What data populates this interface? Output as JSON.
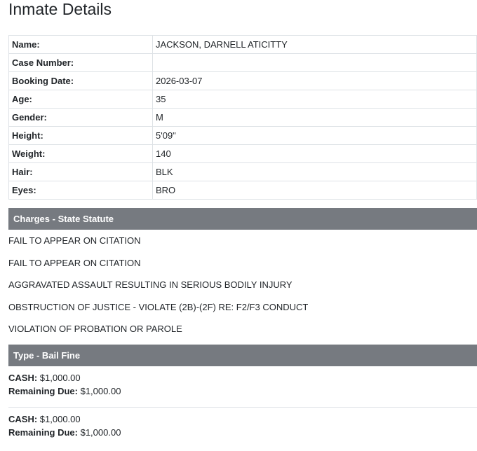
{
  "title": "Inmate Details",
  "details": [
    {
      "label": "Name:",
      "value": "JACKSON, DARNELL ATICITTY"
    },
    {
      "label": "Case Number:",
      "value": ""
    },
    {
      "label": "Booking Date:",
      "value": "2026-03-07"
    },
    {
      "label": "Age:",
      "value": "35"
    },
    {
      "label": "Gender:",
      "value": "M"
    },
    {
      "label": "Height:",
      "value": "5'09\""
    },
    {
      "label": "Weight:",
      "value": "140"
    },
    {
      "label": "Hair:",
      "value": "BLK"
    },
    {
      "label": "Eyes:",
      "value": "BRO"
    }
  ],
  "charges": {
    "header": "Charges - State Statute",
    "items": [
      "FAIL TO APPEAR ON CITATION",
      "FAIL TO APPEAR ON CITATION",
      "AGGRAVATED ASSAULT RESULTING IN SERIOUS BODILY INJURY",
      "OBSTRUCTION OF JUSTICE - VIOLATE (2B)-(2F) RE: F2/F3 CONDUCT",
      "VIOLATION OF PROBATION OR PAROLE"
    ]
  },
  "bail": {
    "header": "Type - Bail Fine",
    "entries": [
      {
        "cash_label": "CASH:",
        "cash": "$1,000.00",
        "remaining_label": "Remaining Due:",
        "remaining": "$1,000.00"
      },
      {
        "cash_label": "CASH:",
        "cash": "$1,000.00",
        "remaining_label": "Remaining Due:",
        "remaining": "$1,000.00"
      }
    ]
  }
}
